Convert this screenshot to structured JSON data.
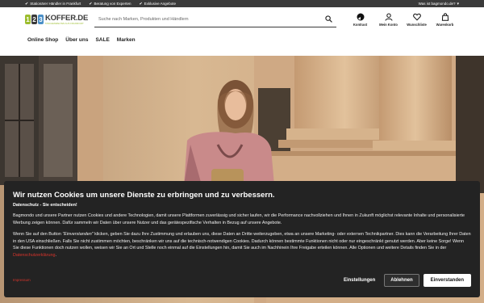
{
  "usp_bar": {
    "items": [
      "Stationärer Händler in Frankfurt",
      "Beratung von Experten",
      "Exklusive Angebote"
    ],
    "how_to": "Was ist bagmondo.de?"
  },
  "logo": {
    "digits": [
      "1",
      "2",
      "3"
    ],
    "name": "KOFFER.DE",
    "tagline": "TASCHENWELTEN AUS FRANKFURT"
  },
  "search": {
    "placeholder": "Suche nach Marken, Produkten und Händlern"
  },
  "actions": [
    {
      "label": "Kontrast",
      "icon": "contrast-icon"
    },
    {
      "label": "Mein Konto",
      "icon": "user-icon"
    },
    {
      "label": "Wunschliste",
      "icon": "heart-icon"
    },
    {
      "label": "Warenkorb",
      "icon": "shopping-bag-icon"
    }
  ],
  "nav": {
    "items": [
      "Online Shop",
      "Über uns",
      "SALE",
      "Marken"
    ]
  },
  "cookie": {
    "title": "Wir nutzen Cookies um unsere Dienste zu erbringen und zu verbessern.",
    "subtitle": "Datenschutz - Sie entscheiden!",
    "paragraph1": "Bagmondo und unsere Partner nutzen Cookies und andere Technologien, damit unsere Plattformen zuverlässig und sicher laufen, wir die Performance nachvollziehen und Ihnen in Zukunft möglichst relevante Inhalte und personalisierte Werbung zeigen können. Dafür sammeln wir Daten über unsere Nutzer und das gerätespezifische Verhalten in Bezug auf unsere Angebote.",
    "p2_part1": "Wenn Sie auf den Button ",
    "p2_em": "\"Einverstanden\"",
    "p2_part2": " klicken, geben Sie dazu Ihre Zustimmung und erlauben uns, diese Daten an Dritte weiterzugeben, etwa an unsere Marketing- oder externen Technikpartner. Dies kann die Verarbeitung Ihrer Daten in den USA einschließen. Falls Sie nicht zustimmen möchten, beschränken wir uns auf die technisch-notwendigen Cookies. Dadurch können bestimmte Funktionen nicht oder nur eingeschränkt genutzt werden. Aber keine Sorge! Wenn Sie diese Funktionen doch nutzen wollen, weisen wir Sie an Ort und Stelle noch einmal auf die Einstellungen hin, damit Sie auch im Nachhinein Ihre Freigabe erteilen können. Alle Optionen und weitere Details finden Sie in der ",
    "privacy_link": "Datenschutzerklärung",
    "p2_end": ".",
    "imprint_link": "Impressum",
    "settings_button": "Einstellungen",
    "decline_button": "Ablehnen",
    "accept_button": "Einverstanden"
  },
  "colors": {
    "topbar": "#3a3a3a",
    "banner_bg": "#232323",
    "link": "#d9342b",
    "logo_green": "#9cbd2e",
    "logo_blue": "#4a8fc7"
  }
}
